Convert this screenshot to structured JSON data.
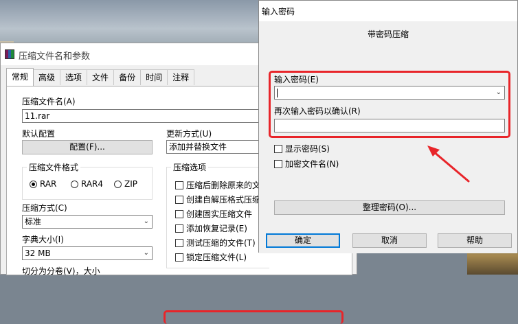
{
  "main_dialog": {
    "title": "压缩文件名和参数",
    "tabs": [
      {
        "label": "常规",
        "active": true
      },
      {
        "label": "高级",
        "active": false
      },
      {
        "label": "选项",
        "active": false
      },
      {
        "label": "文件",
        "active": false
      },
      {
        "label": "备份",
        "active": false
      },
      {
        "label": "时间",
        "active": false
      },
      {
        "label": "注释",
        "active": false
      }
    ],
    "archive_name_label": "压缩文件名(A)",
    "archive_name_value": "11.rar",
    "default_profile_label": "默认配置",
    "profiles_button": "配置(F)...",
    "update_mode_label": "更新方式(U)",
    "update_mode_value": "添加并替换文件",
    "format_group_label": "压缩文件格式",
    "formats": [
      {
        "label": "RAR",
        "selected": true
      },
      {
        "label": "RAR4",
        "selected": false
      },
      {
        "label": "ZIP",
        "selected": false
      }
    ],
    "compression_method_label": "压缩方式(C)",
    "compression_method_value": "标准",
    "dictionary_label": "字典大小(I)",
    "dictionary_value": "32 MB",
    "split_label": "切分为分卷(V)，大小",
    "options_group_label": "压缩选项",
    "options": [
      {
        "label": "压缩后删除原来的文",
        "checked": false
      },
      {
        "label": "创建自解压格式压缩",
        "checked": false
      },
      {
        "label": "创建固实压缩文件",
        "checked": false
      },
      {
        "label": "添加恢复记录(E)",
        "checked": false
      },
      {
        "label": "测试压缩的文件(T)",
        "checked": false
      },
      {
        "label": "锁定压缩文件(L)",
        "checked": false
      }
    ]
  },
  "password_dialog": {
    "title": "输入密码",
    "subtitle": "带密码压缩",
    "enter_password_label": "输入密码(E)",
    "enter_password_value": "",
    "reenter_password_label": "再次输入密码以确认(R)",
    "reenter_password_value": "",
    "show_password_label": "显示密码(S)",
    "show_password_checked": false,
    "encrypt_names_label": "加密文件名(N)",
    "encrypt_names_checked": false,
    "organize_button": "整理密码(O)...",
    "ok_button": "确定",
    "cancel_button": "取消",
    "help_button": "帮助"
  },
  "colors": {
    "highlight_red": "#e8252a",
    "dialog_bg": "#f0f0f0",
    "button_bg": "#e1e1e1"
  },
  "icons": {
    "app": "winrar-icon",
    "dropdown": "chevron-down-icon",
    "annotation": "red-arrow-icon"
  }
}
